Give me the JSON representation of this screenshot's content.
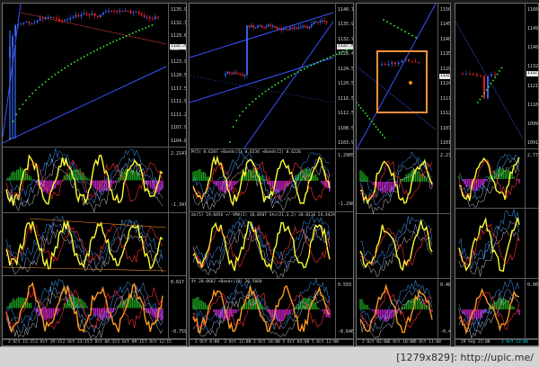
{
  "caption": "[1279x829]: http://upic.me/",
  "colors": {
    "highlight": "#f5913e",
    "bull": "#3a6cff",
    "bear": "#ff2020",
    "sar": "#33ff33",
    "osc": "#ffff33"
  },
  "windows": [
    {
      "name": "chart-1",
      "price_labels": [
        "1135.90",
        "1132.38",
        "1129.65",
        "1127.00",
        "1123.90",
        "1120.50",
        "1117.50",
        "1111.90",
        "1111.25",
        "1107.90",
        "1104.80"
      ],
      "current_price": "1132.76",
      "indicators": [
        {
          "labels": [
            "2.2147",
            "-1.3471"
          ],
          "caption": ""
        },
        {
          "labels": [],
          "caption": ""
        },
        {
          "labels": [
            "0.617",
            "-0.759"
          ],
          "caption": ""
        }
      ],
      "time_labels": [
        "2 Oct 15:15",
        "2 Oct 19:15",
        "2 Oct 23:15",
        "5 Oct 04:15",
        "5 Oct 09:15",
        "5 Oct 12:15"
      ],
      "time_highlight": ""
    },
    {
      "name": "chart-2",
      "price_labels": [
        "1140.70",
        "1135.90",
        "1132.78",
        "1128.40",
        "1124.50",
        "1120.50",
        "1116.50",
        "1112.50",
        "1108.50",
        "1103.90"
      ],
      "current_price": "1132.76",
      "indicators": [
        {
          "labels": [
            "1.2905",
            "-1.2987"
          ],
          "caption": "M(5) 0.6207  +Bands(5) 0.6534  +Bands(2) 0.6226"
        },
        {
          "labels": [],
          "caption": "dx(5) 19.8456  +/-VMA(2) 18.0507  Sto(21,3,2) 20.8116 24.4429"
        },
        {
          "labels": [
            "0.593",
            "-0.646"
          ],
          "caption": "4t 20.0662  +Bands(10) 20.5660"
        }
      ],
      "time_labels": [
        "2 Oct 8:00",
        "2 Oct 11:00",
        "2 Oct 18:00",
        "5 Oct 04:00",
        "5 Oct 12:00"
      ],
      "time_highlight": ""
    },
    {
      "name": "chart-3",
      "price_labels": [
        "1150.10",
        "1145.00",
        "1140.20",
        "1135.60",
        "1129.80",
        "1124.20",
        "1117.90",
        "1112.60",
        "1107.40",
        "1101.60"
      ],
      "current_price": "1132.77",
      "indicators": [
        {
          "labels": [
            "2.2733"
          ],
          "caption": ""
        },
        {
          "labels": [],
          "caption": ""
        },
        {
          "labels": [
            "0.485",
            "-0.457"
          ],
          "caption": ""
        }
      ],
      "time_labels": [
        "2 Oct 02:00",
        "2 Oct 10:00",
        "5 Oct 11:00"
      ],
      "time_highlight": ""
    },
    {
      "name": "chart-4",
      "price_labels": [
        "1160.80",
        "1149.90",
        "1140.45",
        "1132.77",
        "1121.60",
        "1110.85",
        "1099.05",
        "1091.30"
      ],
      "current_price": "1132.77",
      "indicators": [
        {
          "labels": [
            "2.7788"
          ],
          "caption": ""
        },
        {
          "labels": [],
          "caption": ""
        },
        {
          "labels": [
            "0.000"
          ],
          "caption": ""
        }
      ],
      "time_labels": [
        "29 Sep 21:00",
        "2 Oct 13:00"
      ],
      "time_highlight": "2 Oct 13:00"
    }
  ]
}
